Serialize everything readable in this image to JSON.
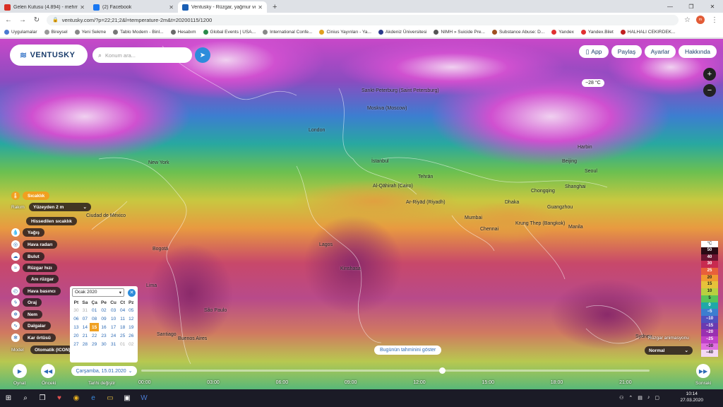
{
  "browser": {
    "tabs": [
      {
        "title": "Gelen Kutusu (4.894) - mehmetc...",
        "favicon_color": "#d93025",
        "active": false
      },
      {
        "title": "(2) Facebook",
        "favicon_color": "#1877f2",
        "active": false
      },
      {
        "title": "Ventusky - Rüzgar, yağmur ve sı...",
        "favicon_color": "#1a5fb4",
        "active": true
      }
    ],
    "new_tab": "+",
    "url": "ventusky.com/?p=22;21;2&l=temperature-2m&t=20200115/1200",
    "profile": "m",
    "bookmarks": [
      "Uygulamalar",
      "Bireysel",
      "Yeni Sekme",
      "Tablo Modern - Binl...",
      "Hesabım",
      "Global Events | USA...",
      "International Confe...",
      "Cinius Yayınları - Ya...",
      "Akdeniz Üniversitesi",
      "NIMH » Suicide Pre...",
      "Substance Abuse: D...",
      "Yandex",
      "Yandex.Bilet",
      "HALHALI CEKIRDEK..."
    ]
  },
  "app": {
    "logo": "VENTUSKY",
    "search_placeholder": "Konum ara...",
    "top_buttons": {
      "app": "App",
      "share": "Paylaş",
      "settings": "Ayarlar",
      "about": "Hakkında"
    },
    "zoom_in": "+",
    "zoom_out": "−",
    "temp_bubble": "−28 °C"
  },
  "layers": {
    "temperature": "Sıcaklık",
    "altitude_label": "Rakım",
    "altitude_value": "Yüzeyden 2 m",
    "feels_like": "Hissedilen sıcaklık",
    "rain": "Yağış",
    "radar": "Hava radarı",
    "clouds": "Bulut",
    "wind_speed": "Rüzgar hızı",
    "gusts": "Anı rüzgar",
    "pressure": "Hava basıncı",
    "storm": "Oraj",
    "humidity": "Nem",
    "waves": "Dalgalar",
    "snow": "Kar örtüsü",
    "model_label": "Model",
    "model_value": "Otomatik (ICON)"
  },
  "calendar": {
    "month": "Ocak 2020",
    "weekdays": [
      "Pt",
      "Sa",
      "Ça",
      "Pe",
      "Cu",
      "Ct",
      "Pz"
    ],
    "weeks": [
      [
        "30",
        "31",
        "01",
        "02",
        "03",
        "04",
        "05"
      ],
      [
        "06",
        "07",
        "08",
        "09",
        "10",
        "11",
        "12"
      ],
      [
        "13",
        "14",
        "15",
        "16",
        "17",
        "18",
        "19"
      ],
      [
        "20",
        "21",
        "22",
        "23",
        "24",
        "25",
        "26"
      ],
      [
        "27",
        "28",
        "29",
        "30",
        "31",
        "01",
        "02"
      ]
    ],
    "selected": "15",
    "selected_date": "Çarşamba, 15.01.2020"
  },
  "timeline": {
    "play": "Oynat",
    "prev": "Önceki",
    "change_date": "Tarihi değiştir",
    "next": "Sonraki",
    "hours": [
      "00:00",
      "03:00",
      "06:00",
      "09:00",
      "12:00",
      "15:00",
      "18:00",
      "21:00"
    ],
    "current_fraction": 0.625,
    "forecast_button": "Bugünün tahminini göster"
  },
  "wind_anim": {
    "label": "Rüzgar animasyonu",
    "value": "Normal"
  },
  "legend": {
    "unit": "°C",
    "stops": [
      {
        "v": "50",
        "c": "#2a0a14",
        "t": "#fff"
      },
      {
        "v": "40",
        "c": "#6e1430",
        "t": "#fff"
      },
      {
        "v": "30",
        "c": "#c82a50",
        "t": "#fff"
      },
      {
        "v": "25",
        "c": "#e8603a",
        "t": "#fff"
      },
      {
        "v": "20",
        "c": "#f09a30",
        "t": "#222"
      },
      {
        "v": "15",
        "c": "#e6c23a",
        "t": "#222"
      },
      {
        "v": "10",
        "c": "#b8d040",
        "t": "#222"
      },
      {
        "v": "5",
        "c": "#58c458",
        "t": "#222"
      },
      {
        "v": "0",
        "c": "#20a8a8",
        "t": "#fff"
      },
      {
        "v": "−5",
        "c": "#3c7ed0",
        "t": "#fff"
      },
      {
        "v": "−10",
        "c": "#5050c0",
        "t": "#fff"
      },
      {
        "v": "−15",
        "c": "#6a3ab0",
        "t": "#fff"
      },
      {
        "v": "−20",
        "c": "#9a30b0",
        "t": "#fff"
      },
      {
        "v": "−25",
        "c": "#c040c8",
        "t": "#fff"
      },
      {
        "v": "−30",
        "c": "#e070e0",
        "t": "#222"
      },
      {
        "v": "−40",
        "c": "#f4d8f4",
        "t": "#222"
      }
    ]
  },
  "cities": [
    "London",
    "Moskva (Moscow)",
    "Sankt-Peterburg (Saint Petersburg)",
    "İstanbul",
    "Tehrān",
    "Al-Qāhirah (Cairo)",
    "Ar-Riyāḍ (Riyadh)",
    "Mumbai",
    "Dhaka",
    "Chennai",
    "Krung Thep (Bangkok)",
    "Manila",
    "Guangzhou",
    "Shanghai",
    "Chongqing",
    "Seoul",
    "Harbin",
    "Beijing",
    "New York",
    "Ciudad de México",
    "Bogotá",
    "Lima",
    "São Paulo",
    "Santiago",
    "Buenos Aires",
    "Lagos",
    "Kinshasa",
    "Sydney"
  ],
  "taskbar": {
    "time": "10:14",
    "date": "27.03.2020"
  }
}
